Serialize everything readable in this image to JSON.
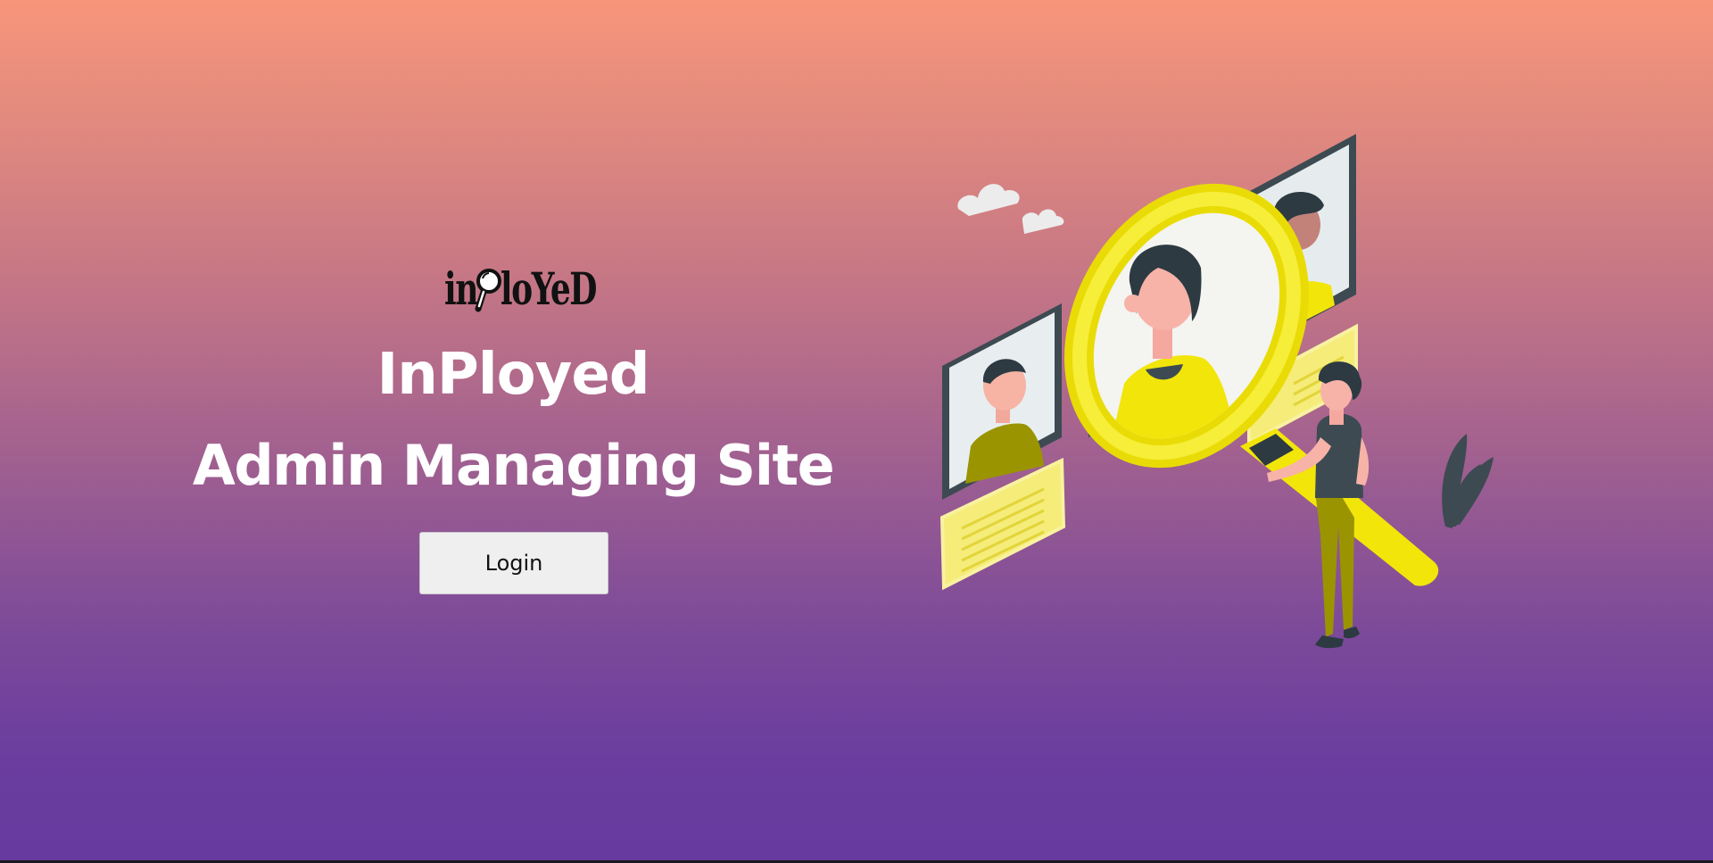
{
  "logo": {
    "text_before": "in",
    "text_after": "loYeD",
    "icon": "magnifying-glass-icon"
  },
  "hero": {
    "title": "InPloyed",
    "subtitle": "Admin Managing Site",
    "login_label": "Login"
  },
  "illustration": {
    "description_icon": "candidate-search-illustration"
  },
  "colors": {
    "gradient_top": "#f7957a",
    "gradient_bottom": "#663a9f",
    "accent_yellow": "#f2e50a",
    "frame_dark": "#3d4a52",
    "button_bg": "#efefef"
  }
}
